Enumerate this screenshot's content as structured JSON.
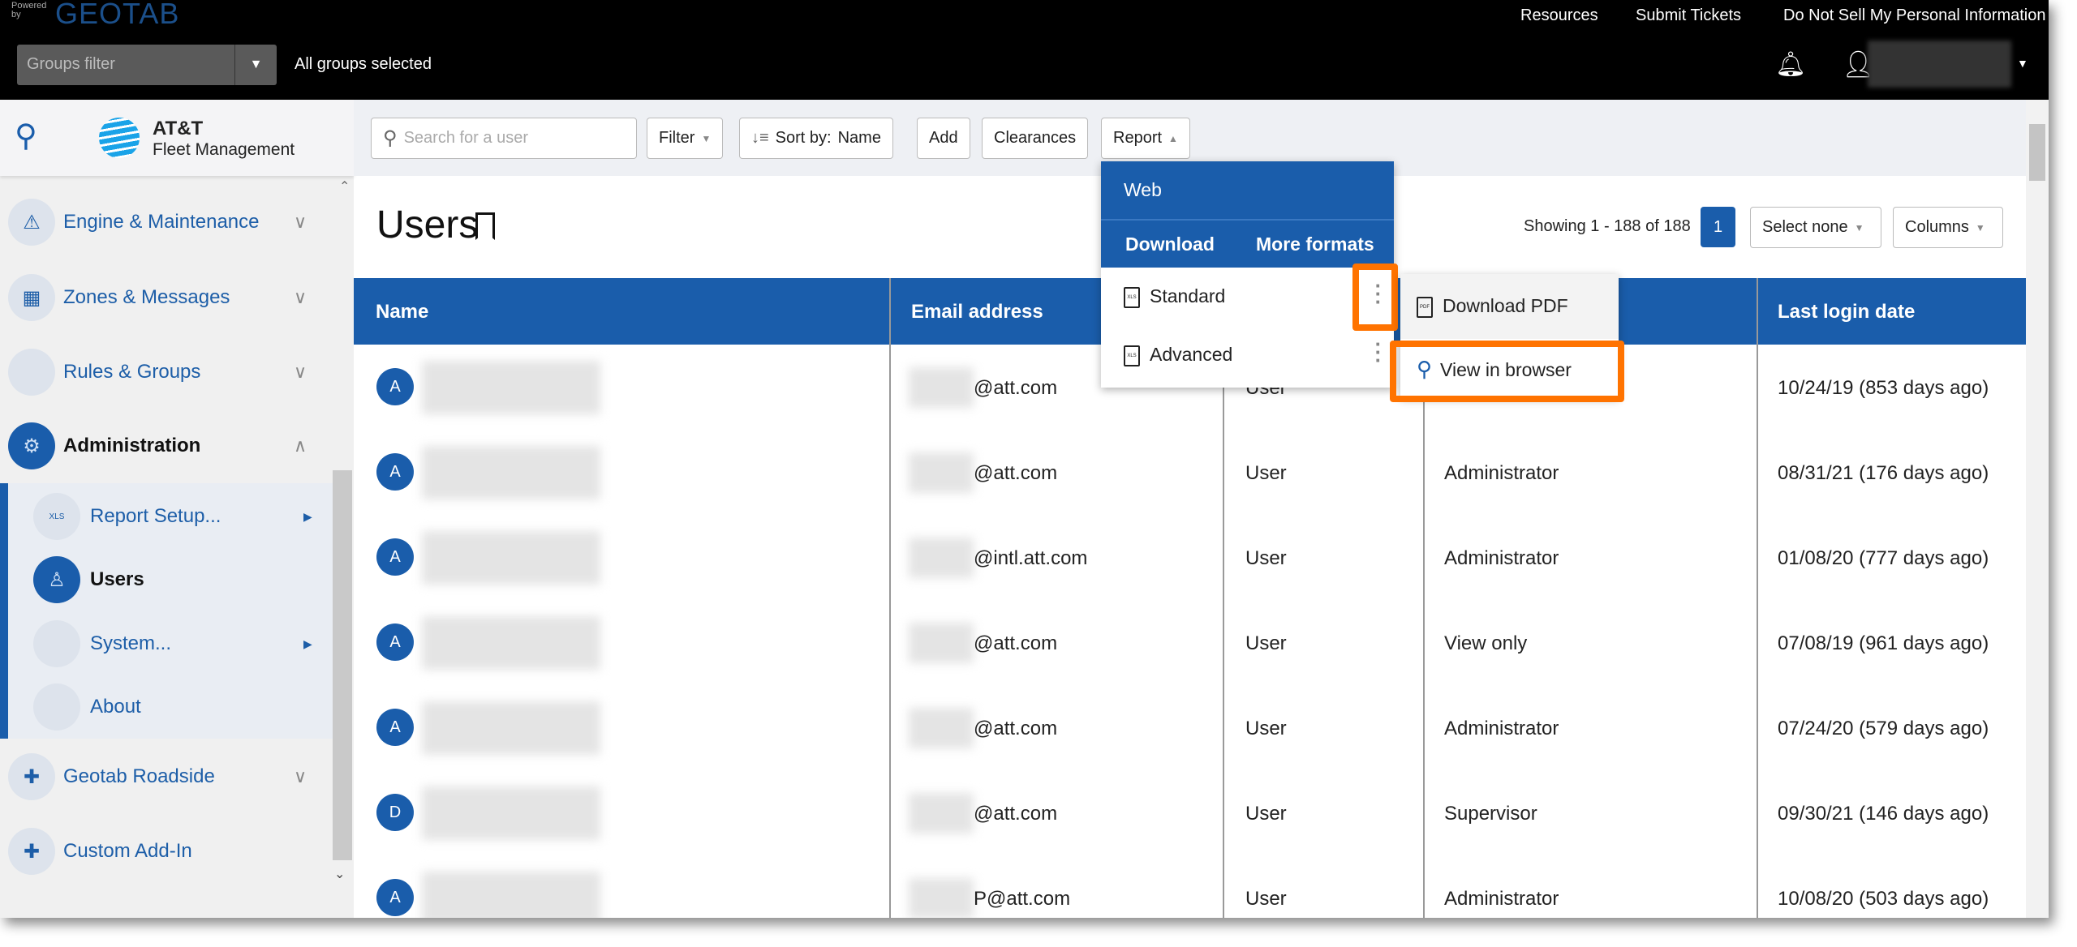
{
  "header": {
    "powered_by": "Powered by",
    "brand": "GEOTAB",
    "groups_filter_placeholder": "Groups filter",
    "groups_status": "All groups selected",
    "links": [
      "Resources",
      "Submit Tickets",
      "Do Not Sell My Personal Information"
    ]
  },
  "sidebar": {
    "logo_line1": "AT&T",
    "logo_line2": "Fleet Management",
    "items": [
      {
        "label": "Engine & Maintenance",
        "icon": "engine-icon"
      },
      {
        "label": "Zones & Messages",
        "icon": "zones-icon"
      },
      {
        "label": "Rules & Groups",
        "icon": ""
      },
      {
        "label": "Administration",
        "icon": "gear-icon"
      },
      {
        "label": "Report Setup...",
        "icon": "xls-icon"
      },
      {
        "label": "Users",
        "icon": "user-icon"
      },
      {
        "label": "System...",
        "icon": ""
      },
      {
        "label": "About",
        "icon": ""
      },
      {
        "label": "Geotab Roadside",
        "icon": "puzzle-icon"
      },
      {
        "label": "Custom Add-In",
        "icon": "puzzle-icon"
      }
    ]
  },
  "toolbar": {
    "search_placeholder": "Search for a user",
    "filter": "Filter",
    "sort_prefix": "Sort by:",
    "sort_value": "Name",
    "add": "Add",
    "clearances": "Clearances",
    "report": "Report"
  },
  "page": {
    "title": "Users",
    "showing": "Showing 1 - 188 of 188",
    "page_number": "1",
    "select_none": "Select none",
    "columns": "Columns"
  },
  "report_menu": {
    "web": "Web",
    "download": "Download",
    "more_formats": "More formats",
    "standard": "Standard",
    "advanced": "Advanced",
    "xls": "XLS"
  },
  "submenu": {
    "download_pdf": "Download PDF",
    "view_in_browser": "View in browser",
    "pdf": "PDF"
  },
  "table": {
    "headers": [
      "Name",
      "Email address",
      "",
      "",
      "Last login date"
    ],
    "rows": [
      {
        "initial": "A",
        "email": "@att.com",
        "type": "User",
        "clearance": "",
        "last_login": "10/24/19 (853 days ago)"
      },
      {
        "initial": "A",
        "email": "@att.com",
        "type": "User",
        "clearance": "Administrator",
        "last_login": "08/31/21 (176 days ago)"
      },
      {
        "initial": "A",
        "email": "@intl.att.com",
        "type": "User",
        "clearance": "Administrator",
        "last_login": "01/08/20 (777 days ago)"
      },
      {
        "initial": "A",
        "email": "@att.com",
        "type": "User",
        "clearance": "View only",
        "last_login": "07/08/19 (961 days ago)"
      },
      {
        "initial": "A",
        "email": "@att.com",
        "type": "User",
        "clearance": "Administrator",
        "last_login": "07/24/20 (579 days ago)"
      },
      {
        "initial": "D",
        "email": "@att.com",
        "type": "User",
        "clearance": "Supervisor",
        "last_login": "09/30/21 (146 days ago)"
      },
      {
        "initial": "A",
        "email": "P@att.com",
        "type": "User",
        "clearance": "Administrator",
        "last_login": "10/08/20 (503 days ago)"
      }
    ]
  },
  "colors": {
    "brand_blue": "#1a5dab",
    "highlight": "#ff7300",
    "topbar": "#000000"
  }
}
